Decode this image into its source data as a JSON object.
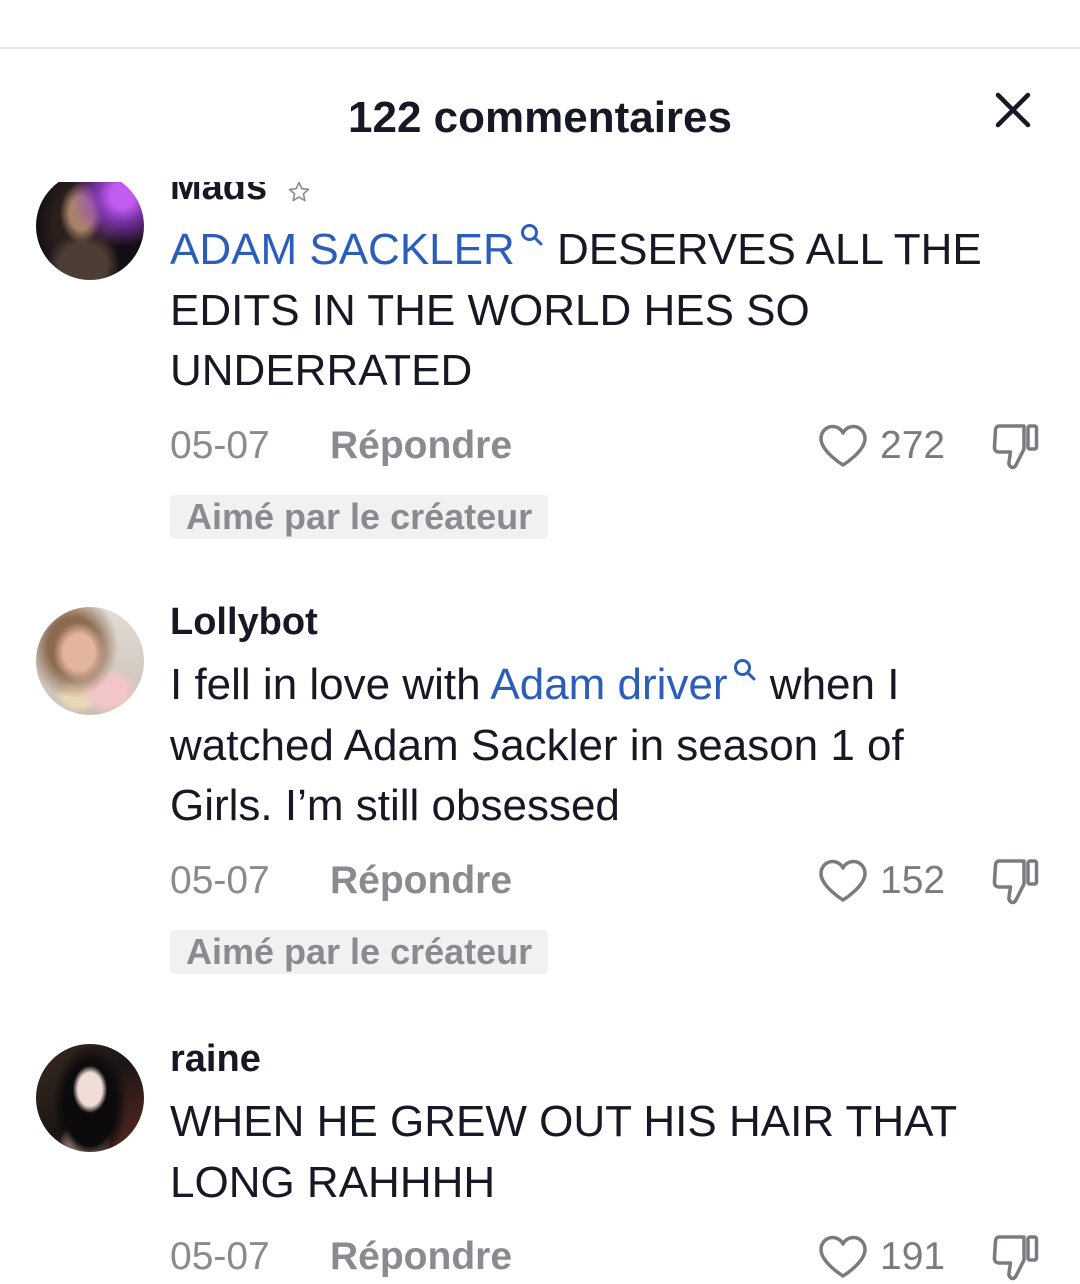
{
  "colors": {
    "text": "#161823",
    "mention": "#2B5DB9",
    "muted": "#8A8B91",
    "icon": "#7A7B81",
    "badge_bg": "#F1F1F2",
    "divider": "#E6E6E8"
  },
  "icons": {
    "close": "close-icon",
    "mention": "search-icon",
    "like": "heart-icon",
    "dislike": "thumbs-down-icon"
  },
  "header": {
    "title": "122 commentaires"
  },
  "comments": [
    {
      "username": "Mads",
      "username_icon": "star-icon",
      "lines": [
        [
          {
            "text": "ADAM SACKLER",
            "mention": true
          },
          {
            "text": " DESERVES ALL THE"
          }
        ],
        [
          {
            "text": "EDITS IN THE WORLD HES SO"
          }
        ],
        [
          {
            "text": "UNDERRATED"
          }
        ]
      ],
      "date": "05-07",
      "reply_label": "Répondre",
      "like_count": "272",
      "liked_by_creator": "Aimé par le créateur"
    },
    {
      "username": "Lollybot",
      "lines": [
        [
          {
            "text": "I fell in love with "
          },
          {
            "text": "Adam driver",
            "mention": true
          },
          {
            "text": " when I"
          }
        ],
        [
          {
            "text": "watched Adam Sackler in season 1 of"
          }
        ],
        [
          {
            "text": "Girls. I’m still obsessed"
          }
        ]
      ],
      "date": "05-07",
      "reply_label": "Répondre",
      "like_count": "152",
      "liked_by_creator": "Aimé par le créateur"
    },
    {
      "username": "raine",
      "lines": [
        [
          {
            "text": "WHEN HE GREW OUT HIS HAIR THAT"
          }
        ],
        [
          {
            "text": "LONG RAHHHH"
          }
        ]
      ],
      "date": "05-07",
      "reply_label": "Répondre",
      "like_count": "191"
    }
  ]
}
